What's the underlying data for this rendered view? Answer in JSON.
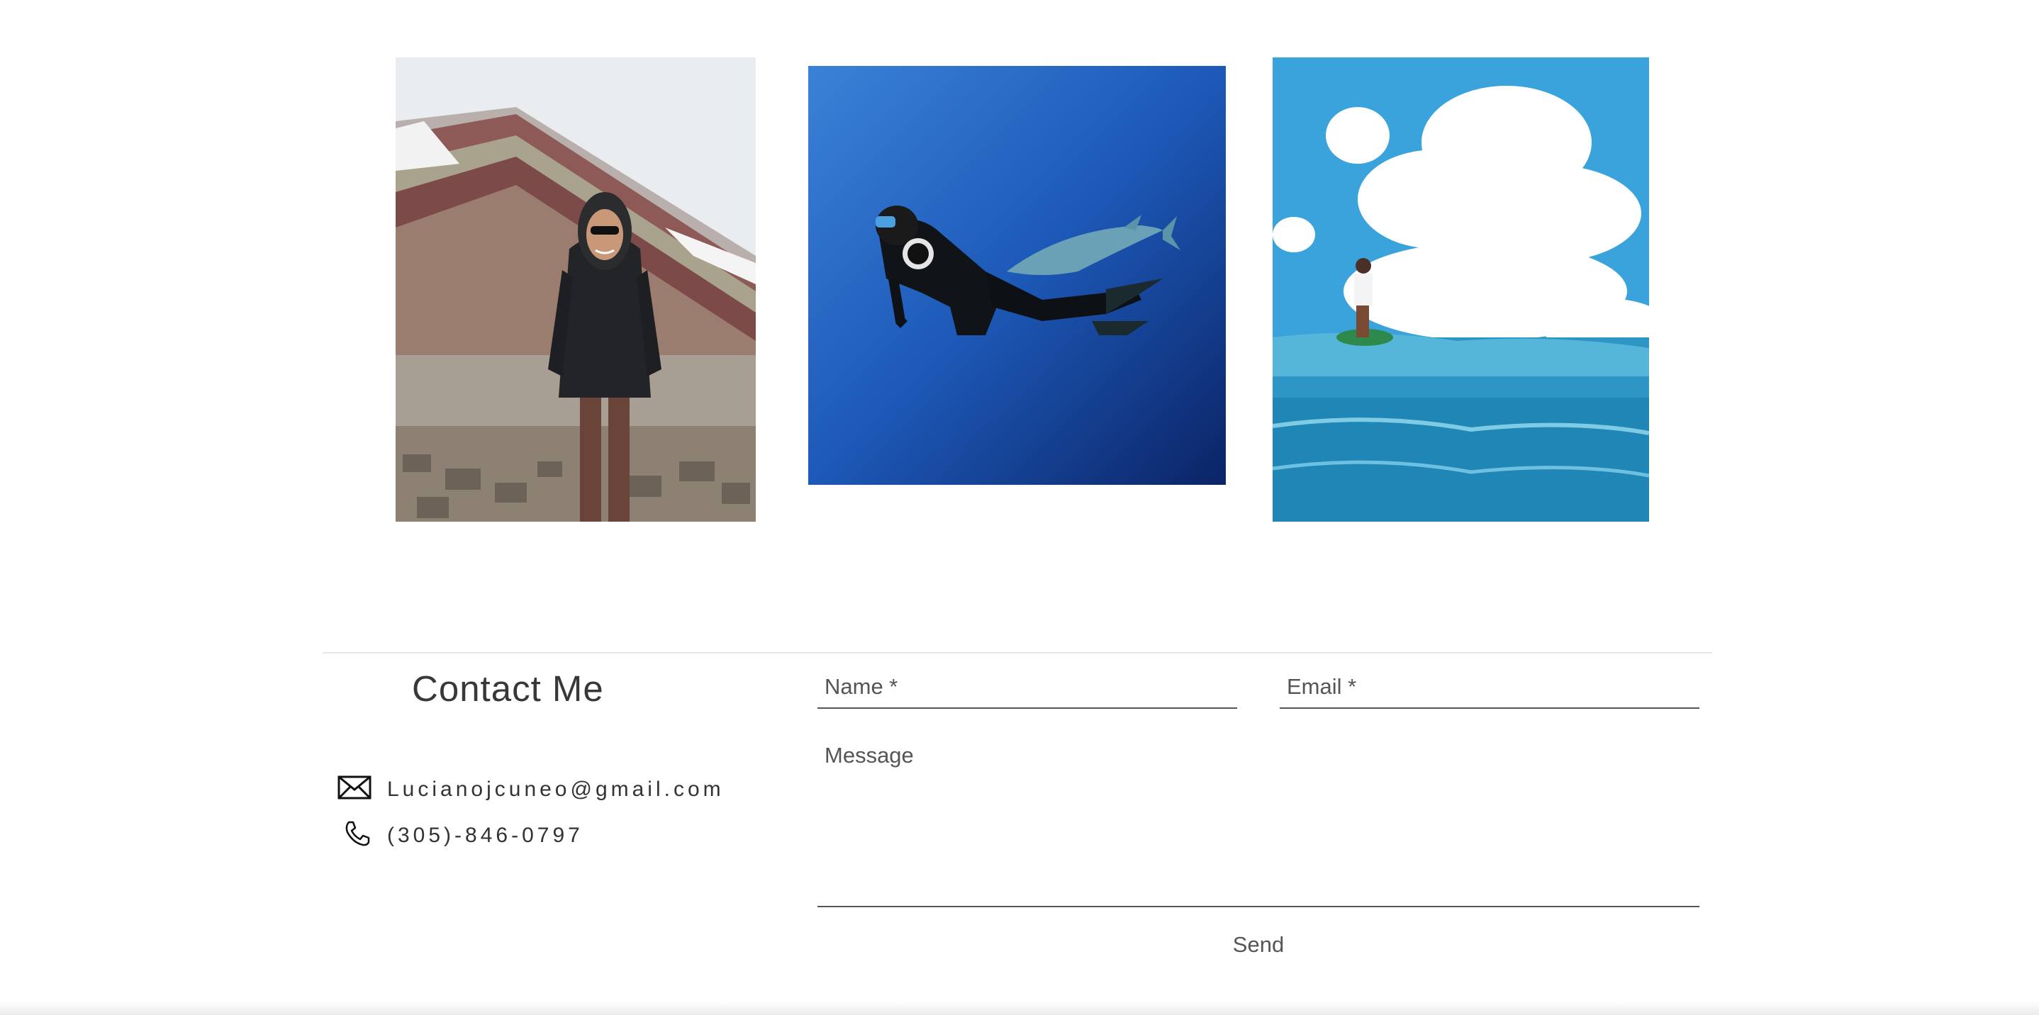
{
  "gallery": {
    "photos": [
      {
        "icon": "mountain-portrait-photo"
      },
      {
        "icon": "freediver-shark-photo"
      },
      {
        "icon": "surfer-wave-photo"
      }
    ]
  },
  "contact": {
    "title": "Contact Me",
    "email": "Lucianojcuneo@gmail.com",
    "phone": "(305)-846-0797",
    "email_icon": "envelope-icon",
    "phone_icon": "phone-icon"
  },
  "form": {
    "name_placeholder": "Name *",
    "email_placeholder": "Email *",
    "message_placeholder": "Message",
    "send_label": "Send"
  }
}
